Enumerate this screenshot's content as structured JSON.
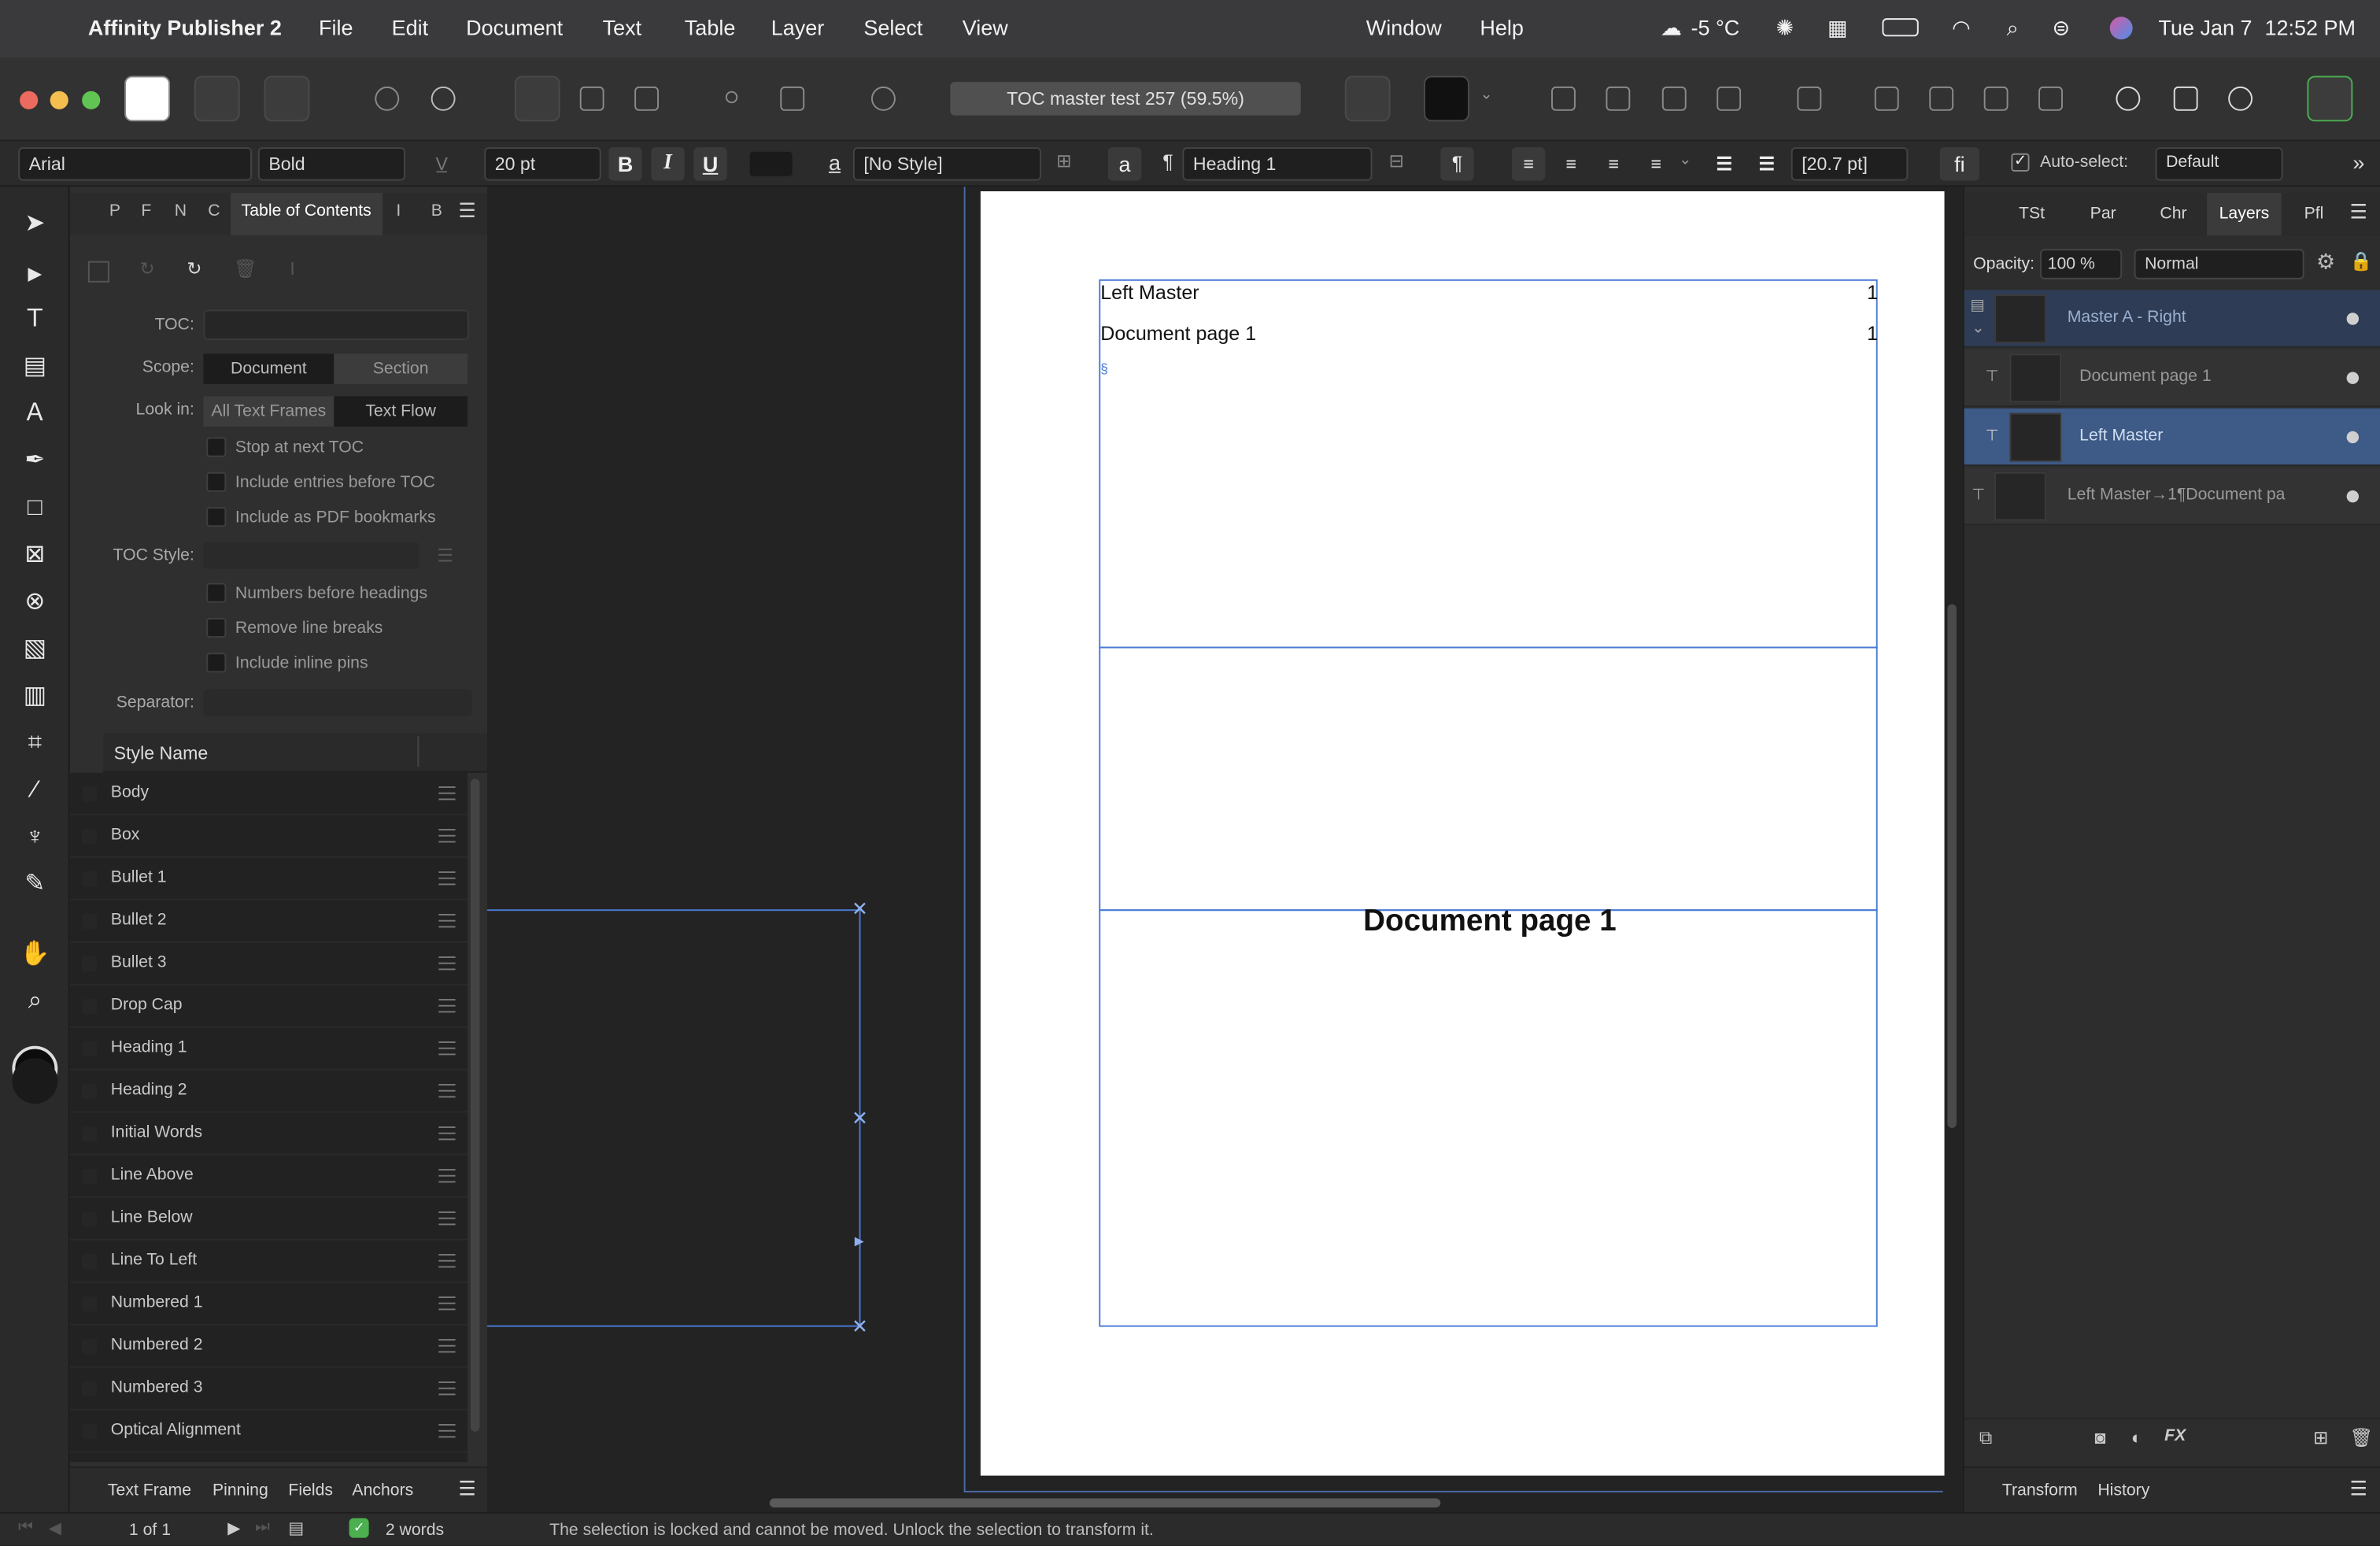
{
  "menubar": {
    "app_name": "Affinity Publisher 2",
    "items": [
      "File",
      "Edit",
      "Document",
      "Text",
      "Table",
      "Layer",
      "Select",
      "View"
    ],
    "right_items": [
      "Window",
      "Help"
    ],
    "weather": "-5 °C",
    "date": "Tue Jan 7",
    "time": "12:52 PM"
  },
  "toolbar": {
    "document_title": "TOC master test 257 (59.5%)"
  },
  "context": {
    "font_family": "Arial",
    "font_style": "Bold",
    "font_size": "20 pt",
    "bold": "B",
    "italic": "I",
    "underline": "U",
    "char_style": "[No Style]",
    "para_symbol": "¶",
    "para_style": "Heading 1",
    "leading": "[20.7 pt]",
    "ligature": "fi",
    "autoselect_label": "Auto-select:",
    "autoselect_value": "Default"
  },
  "left_panel": {
    "tabs": [
      "P",
      "F",
      "N",
      "C",
      "Table of Contents",
      "I",
      "B"
    ],
    "toc_label": "TOC:",
    "scope_label": "Scope:",
    "scope_options": [
      "Document",
      "Section"
    ],
    "lookin_label": "Look in:",
    "lookin_options": [
      "All Text Frames",
      "Text Flow"
    ],
    "checks_a": [
      "Stop at next TOC",
      "Include entries before TOC",
      "Include as PDF bookmarks"
    ],
    "toc_style_label": "TOC Style:",
    "checks_b": [
      "Numbers before headings",
      "Remove line breaks",
      "Include inline pins"
    ],
    "separator_label": "Separator:",
    "style_header": "Style Name",
    "styles": [
      "Body",
      "Box",
      "Bullet 1",
      "Bullet 2",
      "Bullet 3",
      "Drop Cap",
      "Heading 1",
      "Heading 2",
      "Initial Words",
      "Line Above",
      "Line Below",
      "Line To Left",
      "Numbered 1",
      "Numbered 2",
      "Numbered 3",
      "Optical Alignment"
    ],
    "bottom_tabs": [
      "Text Frame",
      "Pinning",
      "Fields",
      "Anchors"
    ]
  },
  "page": {
    "toc_line1_text": "Left Master",
    "toc_line1_num": "1",
    "toc_line2_text": "Document page 1",
    "toc_line2_num": "1",
    "heading": "Document page 1"
  },
  "right_panel": {
    "tabs": [
      "TSt",
      "Par",
      "Chr",
      "Layers",
      "Pfl"
    ],
    "opacity_label": "Opacity:",
    "opacity_value": "100 %",
    "blend_mode": "Normal",
    "layers": [
      "Master A - Right",
      "Document page 1",
      "Left Master",
      "Left Master→1¶Document pa"
    ],
    "bottom_tabs": [
      "Transform",
      "History"
    ]
  },
  "status": {
    "page_indicator": "1 of 1",
    "word_count": "2 words",
    "message": "The selection is locked and cannot be moved. Unlock the selection to transform it."
  },
  "colors": {
    "accent_blue": "#4a7bd5",
    "selected_layer": "#3e5a86"
  }
}
